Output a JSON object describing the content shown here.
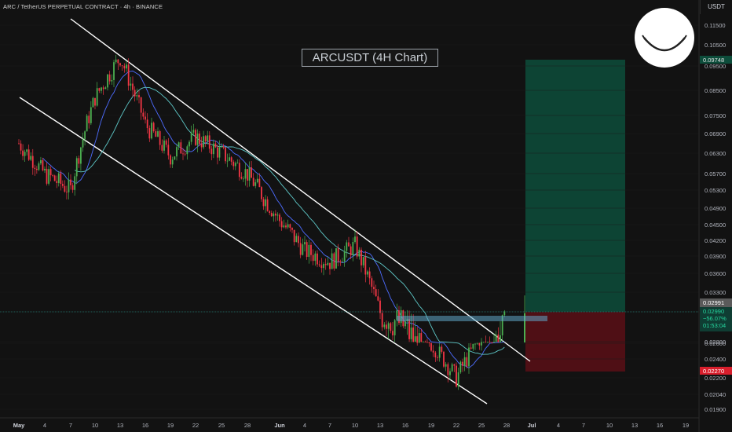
{
  "header": {
    "symbol_line": "ARC / TetherUS PERPETUAL CONTRACT · 4h · BINANCE"
  },
  "axis": {
    "currency": "USDT"
  },
  "chart_title": "ARCUSDT (4H Chart)",
  "colors": {
    "up": "#26a69a",
    "down": "#ef5350",
    "bull_candle": "#4caf50",
    "bear_candle": "#f23645",
    "background": "#121212",
    "target_zone": "#0d5a45",
    "stop_zone": "#6a1018",
    "ma_fast": "#4d6cff",
    "ma_slow": "#5ec8c8",
    "channel": "#ffffff",
    "price_line": "#26a69a"
  },
  "chart_data": {
    "type": "line",
    "description_of_series": "ARCUSDT 4h price (candlestick close approximation)",
    "y_ticks": [
      "0.11500",
      "0.10500",
      "0.09500",
      "0.08500",
      "0.07500",
      "0.06900",
      "0.06300",
      "0.05700",
      "0.05300",
      "0.04900",
      "0.04500",
      "0.04200",
      "0.03900",
      "0.03600",
      "0.03300",
      "0.03000",
      "0.02800",
      "0.02600",
      "0.02400",
      "0.02200",
      "0.02040",
      "0.01900"
    ],
    "x_ticks": [
      "May",
      "4",
      "7",
      "10",
      "13",
      "16",
      "19",
      "22",
      "25",
      "28",
      "Jun",
      "4",
      "7",
      "10",
      "13",
      "16",
      "19",
      "22",
      "25",
      "28",
      "Jul",
      "4",
      "7",
      "10",
      "13",
      "16",
      "19"
    ],
    "series": [
      {
        "x": [
          "May",
          "4",
          "7",
          "10",
          "13",
          "16",
          "19",
          "22",
          "25",
          "28",
          "Jun",
          "4",
          "7",
          "10",
          "13",
          "16",
          "19",
          "22",
          "25",
          "28"
        ],
        "values": [
          0.066,
          0.057,
          0.053,
          0.082,
          0.099,
          0.072,
          0.062,
          0.068,
          0.063,
          0.057,
          0.046,
          0.04,
          0.038,
          0.041,
          0.03,
          0.029,
          0.026,
          0.022,
          0.027,
          0.029
        ]
      }
    ],
    "price_labels": {
      "target": "0.09748",
      "last_close": "0.02991",
      "current": "0.02990",
      "change": "−56.07%",
      "countdown": "01:53:04",
      "stop": "0.02270"
    },
    "annotations": [
      "Descending channel",
      "Long position: entry 0.02991, target 0.09748, stop 0.02270"
    ]
  }
}
